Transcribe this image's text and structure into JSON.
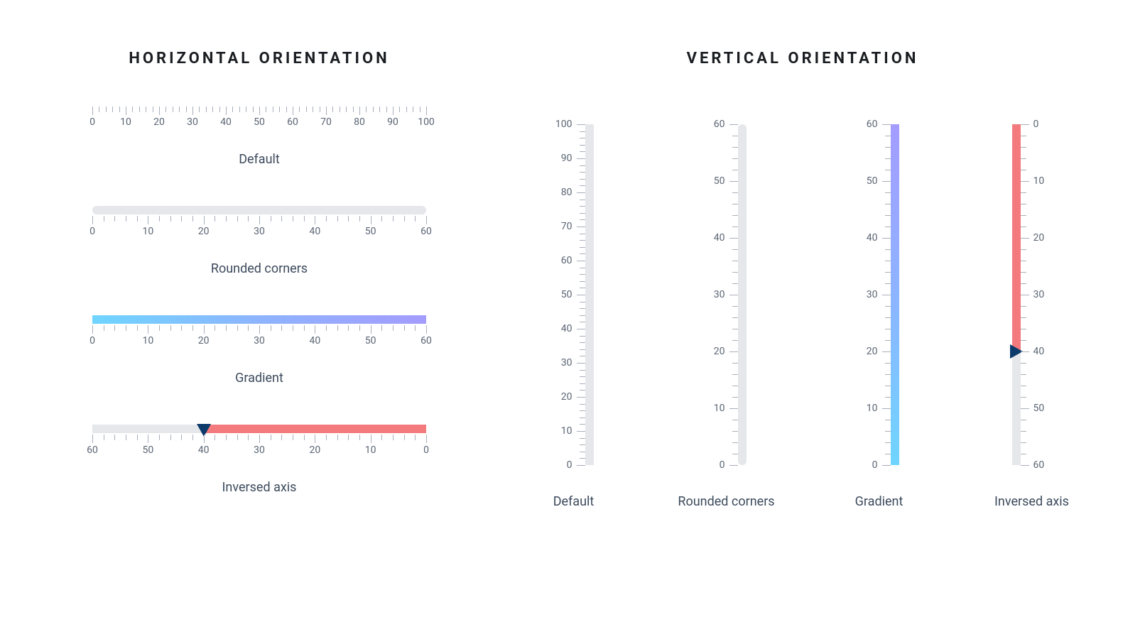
{
  "titles": {
    "horizontal": "HORIZONTAL ORIENTATION",
    "vertical": "VERTICAL ORIENTATION"
  },
  "captions": {
    "default": "Default",
    "rounded": "Rounded corners",
    "gradient": "Gradient",
    "inversed": "Inversed axis"
  },
  "colors": {
    "track": "#e5e7ea",
    "tick": "#a9b0ba",
    "text": "#5a6573",
    "fill": "#f37a7d",
    "marker": "#0b3a6b",
    "gradient_start": "#6fd5ff",
    "gradient_mid": "#8db4ff",
    "gradient_end": "#a49cff"
  },
  "chart_data": [
    {
      "id": "h-default",
      "orientation": "horizontal",
      "variant": "default",
      "min": 0,
      "max": 100,
      "major_step": 10,
      "minor_step": 2,
      "value": null,
      "inverted": false,
      "label": "Default"
    },
    {
      "id": "h-rounded",
      "orientation": "horizontal",
      "variant": "rounded",
      "min": 0,
      "max": 60,
      "major_step": 10,
      "minor_step": 2,
      "value": null,
      "inverted": false,
      "label": "Rounded corners"
    },
    {
      "id": "h-gradient",
      "orientation": "horizontal",
      "variant": "gradient",
      "min": 0,
      "max": 60,
      "major_step": 10,
      "minor_step": 2,
      "value": null,
      "inverted": false,
      "label": "Gradient"
    },
    {
      "id": "h-inversed",
      "orientation": "horizontal",
      "variant": "inversed",
      "min": 0,
      "max": 60,
      "major_step": 10,
      "minor_step": 2,
      "value": 40,
      "inverted": true,
      "label": "Inversed axis"
    },
    {
      "id": "v-default",
      "orientation": "vertical",
      "variant": "default",
      "min": 0,
      "max": 100,
      "major_step": 10,
      "minor_step": 2,
      "value": null,
      "inverted": false,
      "label": "Default"
    },
    {
      "id": "v-rounded",
      "orientation": "vertical",
      "variant": "rounded",
      "min": 0,
      "max": 60,
      "major_step": 10,
      "minor_step": 2,
      "value": null,
      "inverted": false,
      "label": "Rounded corners"
    },
    {
      "id": "v-gradient",
      "orientation": "vertical",
      "variant": "gradient",
      "min": 0,
      "max": 60,
      "major_step": 10,
      "minor_step": 2,
      "value": null,
      "inverted": false,
      "label": "Gradient"
    },
    {
      "id": "v-inversed",
      "orientation": "vertical",
      "variant": "inversed",
      "min": 0,
      "max": 60,
      "major_step": 10,
      "minor_step": 2,
      "value": 40,
      "inverted": true,
      "label": "Inversed axis"
    }
  ]
}
